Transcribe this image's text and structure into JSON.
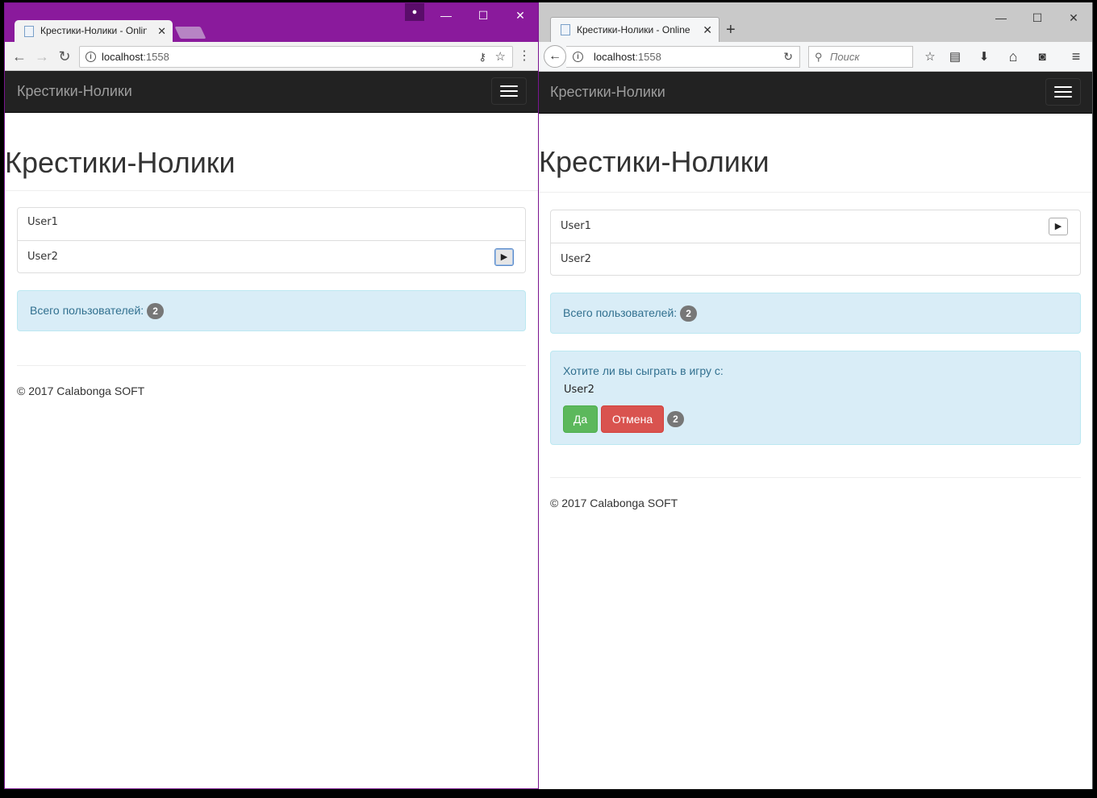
{
  "left": {
    "tab_title": "Крестики-Нолики - Online",
    "url_host": "localhost",
    "url_port": ":1558",
    "page": {
      "brand": "Крестики-Нолики",
      "header": "Крестики-Нолики",
      "users": [
        "User1",
        "User2"
      ],
      "total_label": "Всего пользователей:",
      "total_count": "2",
      "footer": "© 2017 Calabonga SOFT"
    }
  },
  "right": {
    "tab_title": "Крестики-Нолики - Online",
    "url_host": "localhost",
    "url_port": ":1558",
    "search_placeholder": "Поиск",
    "page": {
      "brand": "Крестики-Нолики",
      "header": "Крестики-Нолики",
      "users": [
        "User1",
        "User2"
      ],
      "total_label": "Всего пользователей:",
      "total_count": "2",
      "invite_question": "Хотите ли вы сыграть в игру с:",
      "invite_user": "User2",
      "yes_label": "Да",
      "cancel_label": "Отмена",
      "invite_count": "2",
      "footer": "© 2017 Calabonga SOFT"
    }
  },
  "icons": {
    "minimize": "—",
    "maximize": "☐",
    "close": "✕",
    "back": "←",
    "forward": "→",
    "reload": "↻",
    "info": "i",
    "key": "⚷",
    "star": "☆",
    "menu_dots": "⋮",
    "play": "▶",
    "plus": "+",
    "search": "⚲",
    "reading_list": "▤",
    "download": "⬇",
    "home": "⌂",
    "pocket": "◙",
    "hamburger": "≡",
    "profile": "●"
  },
  "colors": {
    "chrome_frame": "#8a1a9c",
    "navbar": "#222222",
    "alert_info_bg": "#d9edf7",
    "success": "#5cb85c",
    "danger": "#d9534f"
  }
}
